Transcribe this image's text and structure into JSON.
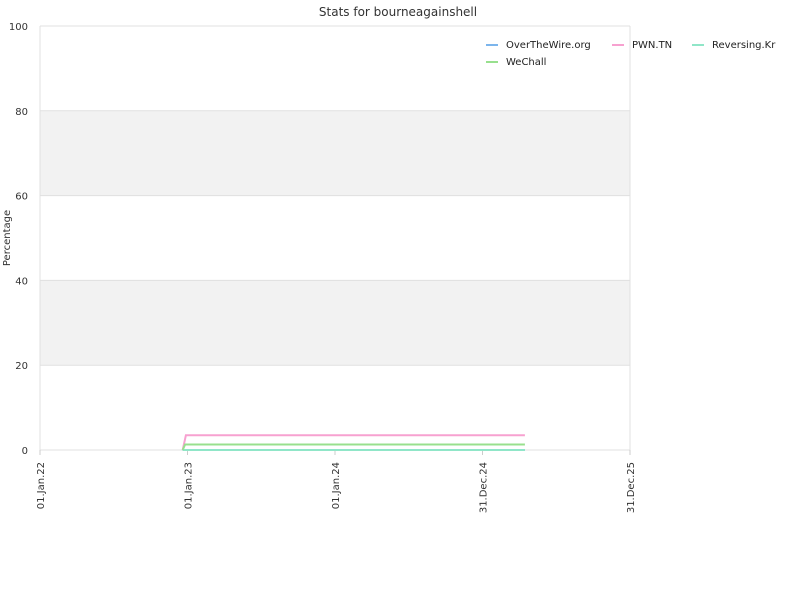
{
  "chart_data": {
    "type": "line",
    "title": "Stats for bourneagainshell",
    "ylabel": "Percentage",
    "xlabel": "",
    "ylim": [
      0,
      100
    ],
    "yticks": [
      0,
      20,
      40,
      60,
      80,
      100
    ],
    "xlim": [
      "2022-01-01",
      "2025-12-31"
    ],
    "xticks": [
      {
        "date": "2022-01-01",
        "label": "01.Jan.22"
      },
      {
        "date": "2023-01-01",
        "label": "01.Jan.23"
      },
      {
        "date": "2024-01-01",
        "label": "01.Jan.24"
      },
      {
        "date": "2024-12-31",
        "label": "31.Dec.24"
      },
      {
        "date": "2025-12-31",
        "label": "31.Dec.25"
      }
    ],
    "grid": "alternating horizontal bands",
    "legend_position": "top-right",
    "series": [
      {
        "name": "OverTheWire.org",
        "color": "#7cb5ec",
        "points": [
          [
            "2022-12-20",
            0
          ],
          [
            "2025-04-15",
            0
          ]
        ]
      },
      {
        "name": "PWN.TN",
        "color": "#f7a1d0",
        "points": [
          [
            "2022-12-20",
            0
          ],
          [
            "2022-12-28",
            3.5
          ],
          [
            "2025-04-15",
            3.5
          ]
        ]
      },
      {
        "name": "Reversing.Kr",
        "color": "#90e6c8",
        "points": [
          [
            "2022-12-20",
            0
          ],
          [
            "2025-04-15",
            0
          ]
        ]
      },
      {
        "name": "WeChall",
        "color": "#98e08e",
        "points": [
          [
            "2022-12-20",
            0
          ],
          [
            "2022-12-26",
            1.3
          ],
          [
            "2025-04-15",
            1.3
          ]
        ]
      }
    ]
  }
}
